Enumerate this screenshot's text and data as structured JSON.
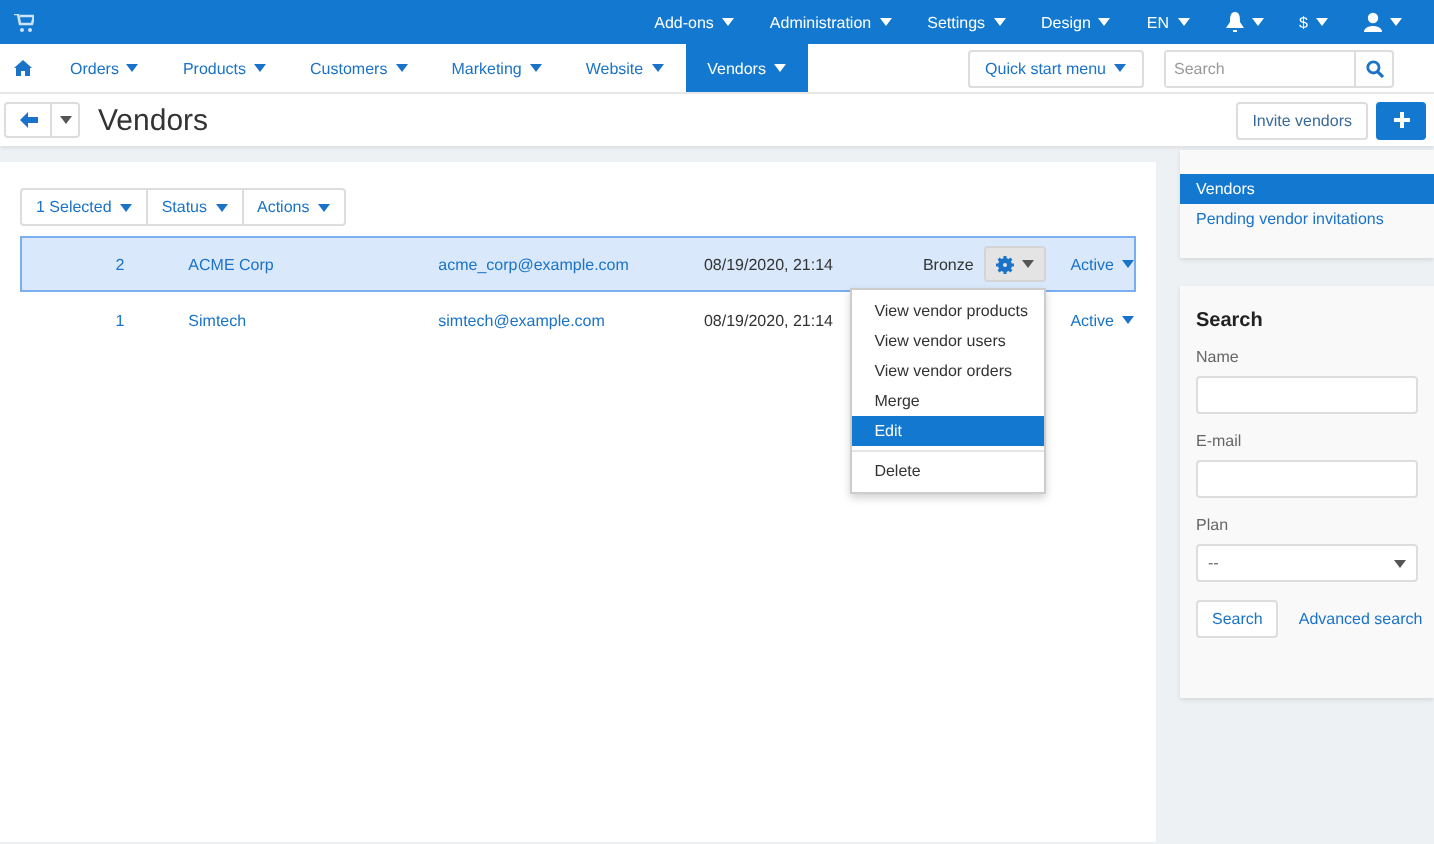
{
  "top_bar": {
    "items": [
      {
        "label": "Add-ons",
        "kind": "text"
      },
      {
        "label": "Administration",
        "kind": "text"
      },
      {
        "label": "Settings",
        "kind": "text"
      },
      {
        "label": "Design",
        "kind": "text"
      },
      {
        "label": "EN",
        "kind": "text"
      },
      {
        "kind": "bell"
      },
      {
        "label": "$",
        "kind": "text"
      },
      {
        "kind": "user"
      }
    ]
  },
  "nav": {
    "tabs": [
      {
        "label": "Orders",
        "selected": false
      },
      {
        "label": "Products",
        "selected": false
      },
      {
        "label": "Customers",
        "selected": false
      },
      {
        "label": "Marketing",
        "selected": false
      },
      {
        "label": "Website",
        "selected": false
      },
      {
        "label": "Vendors",
        "selected": true
      }
    ],
    "quick_start": "Quick start menu",
    "search": {
      "placeholder": "Search"
    }
  },
  "page": {
    "title": "Vendors",
    "invite_button": "Invite vendors"
  },
  "bulk_buttons": [
    "1 Selected",
    "Status",
    "Actions"
  ],
  "table": {
    "rows": [
      {
        "id": "2",
        "name": "ACME Corp",
        "email": "acme_corp@example.com",
        "date": "08/19/2020, 21:14",
        "plan": "Bronze",
        "status": "Active",
        "selected": true,
        "menu_open": true
      },
      {
        "id": "1",
        "name": "Simtech",
        "email": "simtech@example.com",
        "date": "08/19/2020, 21:14",
        "status": "Active",
        "selected": false,
        "menu_open": false
      }
    ]
  },
  "row_menu": {
    "items": [
      {
        "label": "View vendor products",
        "selected": false
      },
      {
        "label": "View vendor users",
        "selected": false
      },
      {
        "label": "View vendor orders",
        "selected": false
      },
      {
        "label": "Merge",
        "selected": false
      },
      {
        "label": "Edit",
        "selected": true
      },
      {
        "label": "Delete",
        "selected": false,
        "divider_before": true
      }
    ]
  },
  "sidebar": {
    "items": [
      {
        "label": "Vendors",
        "selected": true
      },
      {
        "label": "Pending vendor invitations",
        "selected": false
      }
    ],
    "search": {
      "title": "Search",
      "fields": [
        {
          "label": "Name",
          "kind": "input"
        },
        {
          "label": "E-mail",
          "kind": "input"
        },
        {
          "label": "Plan",
          "kind": "select",
          "value": "--"
        }
      ],
      "button": "Search",
      "link": "Advanced search"
    }
  }
}
